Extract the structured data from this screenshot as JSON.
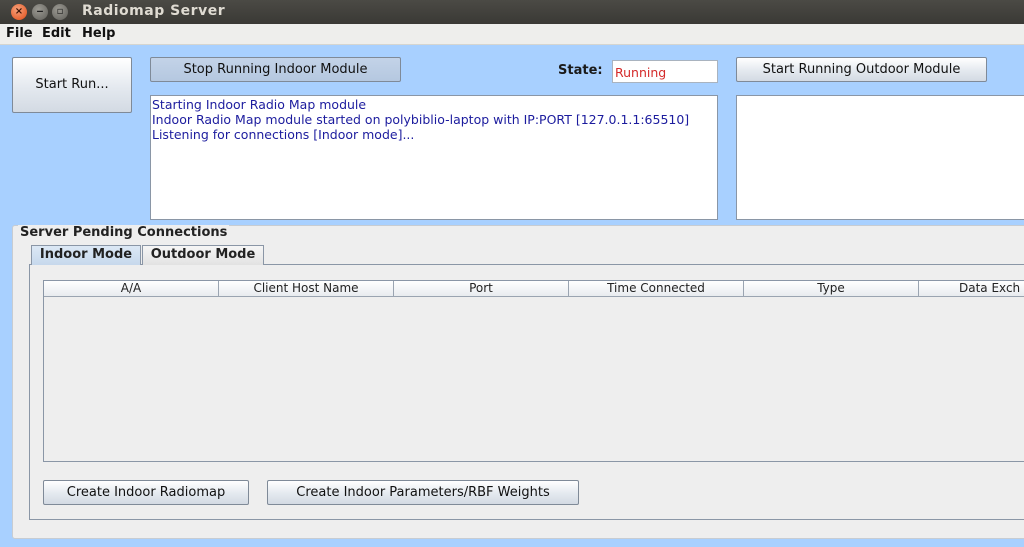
{
  "window": {
    "title": "Radiomap Server",
    "close_glyph": "×",
    "min_glyph": "‒",
    "max_glyph": "▫"
  },
  "menu": [
    "File",
    "Edit",
    "Help"
  ],
  "controls": {
    "start_run_label": "Start Run...",
    "stop_indoor_label": "Stop Running Indoor Module",
    "state_label": "State:",
    "state_value": "Running",
    "start_outdoor_label": "Start Running Outdoor Module"
  },
  "indoor_log": [
    "Starting Indoor Radio Map module",
    "Indoor Radio Map module started on polybiblio-laptop with IP:PORT [127.0.1.1:65510]",
    "Listening for connections [Indoor mode]..."
  ],
  "outdoor_log": [],
  "pending": {
    "title": "Server Pending Connections",
    "tabs": [
      "Indoor Mode",
      "Outdoor Mode"
    ],
    "active_tab": "Indoor Mode",
    "columns": [
      "A/A",
      "Client Host Name",
      "Port",
      "Time Connected",
      "Type",
      "Data Exch"
    ],
    "rows": []
  },
  "actions": {
    "create_radiomap_label": "Create Indoor Radiomap",
    "create_params_label": "Create Indoor Parameters/RBF Weights"
  },
  "colors": {
    "background": "#a8d0ff",
    "state_running": "#d42a2a",
    "log_text": "#1c1c9e"
  }
}
